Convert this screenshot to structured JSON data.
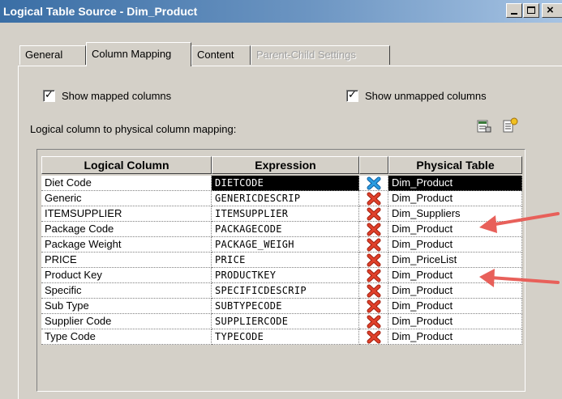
{
  "window": {
    "title": "Logical Table Source - Dim_Product",
    "controls": {
      "minimize": "_",
      "maximize": "□",
      "close": "×"
    }
  },
  "tabs": [
    {
      "label": "General",
      "state": "normal"
    },
    {
      "label": "Column Mapping",
      "state": "active"
    },
    {
      "label": "Content",
      "state": "normal"
    },
    {
      "label": "Parent-Child Settings",
      "state": "disabled"
    }
  ],
  "options": {
    "show_mapped": {
      "label": "Show mapped columns",
      "checked": true
    },
    "show_unmapped": {
      "label": "Show unmapped columns",
      "checked": true
    }
  },
  "mapping_caption": "Logical column to physical column mapping:",
  "toolbar": {
    "icons": [
      "edit-mapping-icon",
      "new-mapping-icon"
    ]
  },
  "grid": {
    "headers": [
      "Logical Column",
      "Expression",
      "",
      "Physical Table"
    ],
    "rows": [
      {
        "logical": "Diet Code",
        "expression": "DIETCODE",
        "physical": "Dim_Product",
        "selected": true
      },
      {
        "logical": "Generic",
        "expression": "GENERICDESCRIP",
        "physical": "Dim_Product",
        "selected": false
      },
      {
        "logical": "ITEMSUPPLIER",
        "expression": "ITEMSUPPLIER",
        "physical": "Dim_Suppliers",
        "selected": false
      },
      {
        "logical": "Package Code",
        "expression": "PACKAGECODE",
        "physical": "Dim_Product",
        "selected": false
      },
      {
        "logical": "Package Weight",
        "expression": "PACKAGE_WEIGH",
        "physical": "Dim_Product",
        "selected": false
      },
      {
        "logical": "PRICE",
        "expression": "PRICE",
        "physical": "Dim_PriceList",
        "selected": false
      },
      {
        "logical": "Product Key",
        "expression": "PRODUCTKEY",
        "physical": "Dim_Product",
        "selected": false
      },
      {
        "logical": "Specific",
        "expression": "SPECIFICDESCRIP",
        "physical": "Dim_Product",
        "selected": false
      },
      {
        "logical": "Sub Type",
        "expression": "SUBTYPECODE",
        "physical": "Dim_Product",
        "selected": false
      },
      {
        "logical": "Supplier Code",
        "expression": "SUPPLIERCODE",
        "physical": "Dim_Product",
        "selected": false
      },
      {
        "logical": "Type Code",
        "expression": "TYPECODE",
        "physical": "Dim_Product",
        "selected": false
      }
    ]
  },
  "annotations": {
    "arrow_rows": [
      "ITEMSUPPLIER",
      "PRICE"
    ],
    "color": "#e8605a"
  },
  "colors": {
    "titlebar": "#3a6ea5",
    "dialog": "#d4d0c8",
    "delete_x": "#e0402a",
    "selected_x": "#2a9be0",
    "arrow": "#e8605a"
  }
}
